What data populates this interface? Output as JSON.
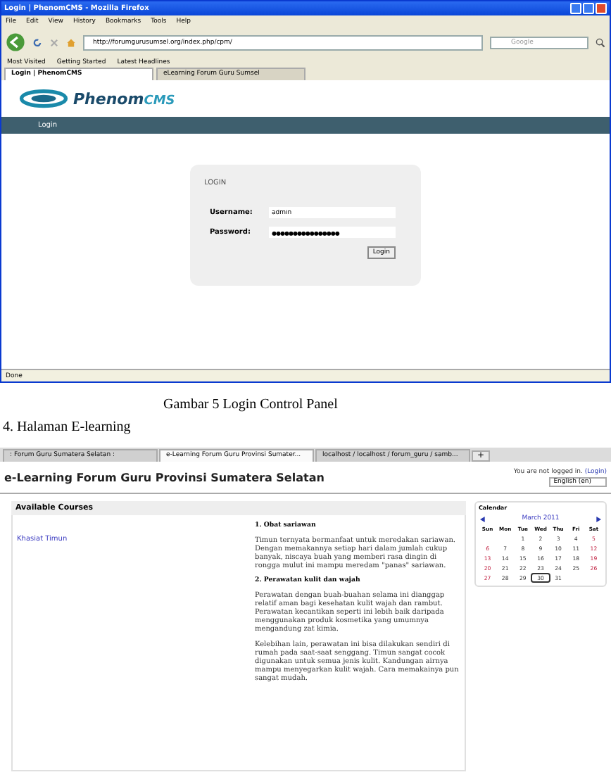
{
  "login_screenshot": {
    "window": {
      "title": "Login | PhenomCMS - Mozilla Firefox"
    },
    "menu": [
      "File",
      "Edit",
      "View",
      "History",
      "Bookmarks",
      "Tools",
      "Help"
    ],
    "address": "http://forumgurusumsel.org/index.php/cpm/",
    "search": {
      "placeholder": "Google"
    },
    "bookmarks": [
      "Most Visited",
      "Getting Started",
      "Latest Headlines"
    ],
    "tabs": [
      {
        "label": "Login | PhenomCMS",
        "selected": true
      },
      {
        "label": "eLearning Forum Guru Sumsel",
        "selected": false
      }
    ],
    "logo": {
      "name": "Phenom",
      "suffix": "CMS"
    },
    "nav": [
      "Login"
    ],
    "form": {
      "title": "LOGIN",
      "fields": [
        {
          "label": "Username:",
          "value": "admin",
          "kind": "text"
        },
        {
          "label": "Password:",
          "value": "●●●●●●●●●●●●●●●●",
          "kind": "password"
        }
      ],
      "button": "Login"
    },
    "status_bar": "Done"
  },
  "caption": "Gambar 5 Login Control Panel",
  "heading": "4. Halaman E-learning",
  "elearning_screenshot": {
    "tabs": [
      {
        "label": ": Forum Guru Sumatera Selatan :",
        "selected": false
      },
      {
        "label": "e-Learning Forum Guru Provinsi Sumater...",
        "selected": true
      },
      {
        "label": "localhost / localhost / forum_guru / samb...",
        "selected": false
      }
    ],
    "new_tab": "+",
    "site_title": "e-Learning Forum Guru Provinsi Sumatera Selatan",
    "login_info": "You are not logged in.",
    "login_link": "(Login)",
    "language": "English (en)",
    "courses_heading": "Available Courses",
    "course": "Khasiat Timun",
    "article": [
      {
        "kind": "heading",
        "text": "1. Obat sariawan"
      },
      {
        "kind": "para",
        "text": "Timun ternyata bermanfaat untuk meredakan sariawan. Dengan memakannya setiap hari dalam jumlah cukup banyak, niscaya buah yang memberi rasa dingin di rongga mulut ini mampu meredam \"panas\" sariawan."
      },
      {
        "kind": "heading",
        "text": "2. Perawatan kulit dan wajah"
      },
      {
        "kind": "para",
        "text": "Perawatan dengan buah-buahan selama ini dianggap relatif aman bagi kesehatan kulit wajah dan rambut. Perawatan kecantikan seperti ini lebih baik daripada menggunakan produk kosmetika yang umumnya mengandung zat kimia."
      },
      {
        "kind": "para",
        "text": "Kelebihan lain, perawatan ini bisa dilakukan sendiri di rumah pada saat-saat senggang. Timun sangat cocok digunakan untuk semua jenis kulit. Kandungan airnya mampu menyegarkan kulit wajah. Cara memakainya pun sangat mudah."
      }
    ],
    "calendar": {
      "title": "Calendar",
      "month": "March 2011",
      "weekdays": [
        "Sun",
        "Mon",
        "Tue",
        "Wed",
        "Thu",
        "Fri",
        "Sat"
      ],
      "weeks": [
        [
          {
            "day": "1",
            "today": false
          },
          {
            "day": "2",
            "today": false
          },
          {
            "day": "3",
            "today": false
          },
          {
            "day": "4",
            "today": false
          },
          {
            "day": "5",
            "today": false
          }
        ],
        [
          {
            "day": "6",
            "today": false
          },
          {
            "day": "7",
            "today": false
          },
          {
            "day": "8",
            "today": false
          },
          {
            "day": "9",
            "today": false
          },
          {
            "day": "10",
            "today": false
          },
          {
            "day": "11",
            "today": false
          },
          {
            "day": "12",
            "today": false
          }
        ],
        [
          {
            "day": "13",
            "today": false
          },
          {
            "day": "14",
            "today": false
          },
          {
            "day": "15",
            "today": false
          },
          {
            "day": "16",
            "today": false
          },
          {
            "day": "17",
            "today": false
          },
          {
            "day": "18",
            "today": false
          },
          {
            "day": "19",
            "today": false
          }
        ],
        [
          {
            "day": "20",
            "today": false
          },
          {
            "day": "21",
            "today": false
          },
          {
            "day": "22",
            "today": false
          },
          {
            "day": "23",
            "today": false
          },
          {
            "day": "24",
            "today": false
          },
          {
            "day": "25",
            "today": false
          },
          {
            "day": "26",
            "today": false
          }
        ],
        [
          {
            "day": "27",
            "today": false
          },
          {
            "day": "28",
            "today": false
          },
          {
            "day": "29",
            "today": false
          },
          {
            "day": "30",
            "today": true
          },
          {
            "day": "31",
            "today": false
          }
        ]
      ]
    }
  }
}
